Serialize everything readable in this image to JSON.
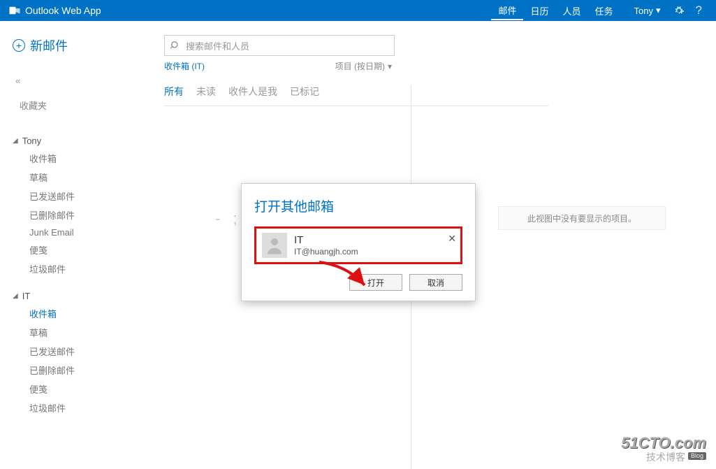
{
  "app_title": "Outlook Web App",
  "header_nav": {
    "mail": "邮件",
    "calendar": "日历",
    "people": "人员",
    "tasks": "任务"
  },
  "user_name": "Tony",
  "sidebar": {
    "new_mail": "新邮件",
    "collapse": "«",
    "favorites": "收藏夹",
    "account1": {
      "name": "Tony",
      "folders": {
        "inbox": "收件箱",
        "drafts": "草稿",
        "sent": "已发送邮件",
        "deleted": "已删除邮件",
        "junk": "Junk Email",
        "notes": "便笺",
        "trash": "垃圾邮件"
      }
    },
    "account2": {
      "name": "IT",
      "folders": {
        "inbox": "收件箱",
        "drafts": "草稿",
        "sent": "已发送邮件",
        "deleted": "已删除邮件",
        "notes": "便笺",
        "trash": "垃圾邮件"
      }
    }
  },
  "search_placeholder": "搜索邮件和人员",
  "crumb": "收件箱 (IT)",
  "sortby": "项目 (按日期)",
  "filters": {
    "all": "所有",
    "unread": "未读",
    "to_me": "收件人是我",
    "flagged": "已标记"
  },
  "empty_list_placeholder": "- ;",
  "empty_reading_pane": "此视图中没有要显示的项目。",
  "dialog": {
    "title": "打开其他邮箱",
    "name": "IT",
    "email": "IT@huangjh.com",
    "clear": "✕",
    "open": "打开",
    "cancel": "取消"
  },
  "watermark": {
    "top": "51CTO.com",
    "bottom": "技术博客",
    "tag": "Blog"
  }
}
